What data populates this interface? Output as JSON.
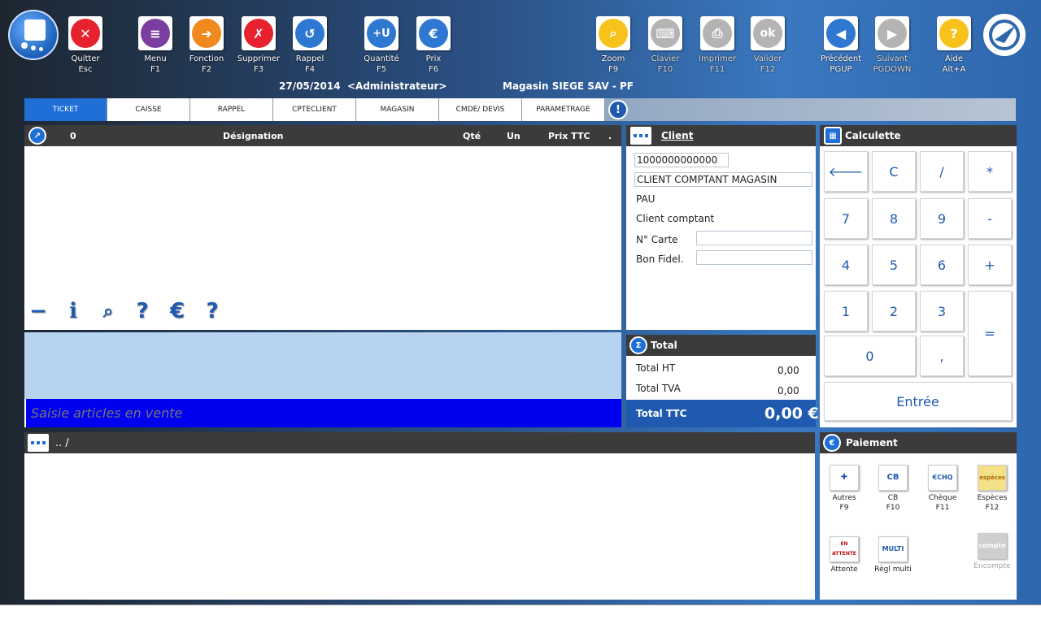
{
  "toolbar": [
    {
      "id": "quit",
      "label": "Quitter",
      "key": "Esc",
      "color": "#e8212e",
      "glyph": "✕",
      "disabled": false
    },
    {
      "id": "menu",
      "label": "Menu",
      "key": "F1",
      "color": "#7a3ea0",
      "glyph": "≡",
      "disabled": false
    },
    {
      "id": "function",
      "label": "Fonction",
      "key": "F2",
      "color": "#f08a1e",
      "glyph": "➜",
      "disabled": false
    },
    {
      "id": "delete",
      "label": "Supprimer",
      "key": "F3",
      "color": "#e8212e",
      "glyph": "✗",
      "disabled": false
    },
    {
      "id": "recall",
      "label": "Rappel",
      "key": "F4",
      "color": "#2f78d2",
      "glyph": "↺",
      "disabled": false
    },
    {
      "id": "quantity",
      "label": "Quantité",
      "key": "F5",
      "color": "#2f78d2",
      "glyph": "+U",
      "disabled": false
    },
    {
      "id": "price",
      "label": "Prix",
      "key": "F6",
      "color": "#2f78d2",
      "glyph": "€",
      "disabled": false
    },
    {
      "id": "zoom",
      "label": "Zoom",
      "key": "F9",
      "color": "#f7c31b",
      "glyph": "⌕",
      "disabled": false
    },
    {
      "id": "keyboard",
      "label": "Clavier",
      "key": "F10",
      "color": "#b4b4b4",
      "glyph": "⌨",
      "disabled": true
    },
    {
      "id": "print",
      "label": "Imprimer",
      "key": "F11",
      "color": "#b4b4b4",
      "glyph": "⎙",
      "disabled": true
    },
    {
      "id": "validate",
      "label": "Valider",
      "key": "F12",
      "color": "#b4b4b4",
      "glyph": "ok",
      "disabled": true
    },
    {
      "id": "previous",
      "label": "Précédent",
      "key": "PGUP",
      "color": "#2f78d2",
      "glyph": "◀",
      "disabled": false
    },
    {
      "id": "next",
      "label": "Suivant",
      "key": "PGDOWN",
      "color": "#b4b4b4",
      "glyph": "▶",
      "disabled": true
    },
    {
      "id": "help",
      "label": "Aide",
      "key": "Alt+A",
      "color": "#f7c31b",
      "glyph": "?",
      "disabled": false
    }
  ],
  "infobar": {
    "date": "27/05/2014",
    "user": "<Administrateur>",
    "store": "Magasin SIEGE SAV - PF"
  },
  "tabs": [
    "TICKET",
    "CAISSE",
    "RAPPEL",
    "CPTECLIENT",
    "MAGASIN",
    "CMDE/ DEVIS",
    "PARAMETRAGE"
  ],
  "ticket": {
    "count": "0",
    "columns": {
      "designation": "Désignation",
      "qty": "Qté",
      "unit": "Un",
      "price": "Prix TTC",
      "dot": "."
    },
    "icons": [
      "minus-icon",
      "info-icon",
      "search-icon",
      "help-icon",
      "euro-net-icon",
      "help2-icon"
    ]
  },
  "entry": {
    "placeholder": "Saisie articles en vente"
  },
  "client": {
    "title": "Client",
    "code": "1000000000000",
    "name": "CLIENT COMPTANT MAGASIN",
    "city": "PAU",
    "type": "Client comptant",
    "card_label": "N° Carte",
    "card_value": "",
    "fidel_label": "Bon Fidel.",
    "fidel_value": ""
  },
  "total": {
    "title": "Total",
    "ht_label": "Total HT",
    "ht_value": "0,00",
    "tva_label": "Total TVA",
    "tva_value": "0,00",
    "ttc_label": "Total TTC",
    "ttc_value": "0,00 €"
  },
  "calc": {
    "title": "Calculette",
    "keys": {
      "back": "🡐",
      "c": "C",
      "div": "/",
      "mul": "*",
      "k7": "7",
      "k8": "8",
      "k9": "9",
      "minus": "-",
      "k4": "4",
      "k5": "5",
      "k6": "6",
      "plus": "+",
      "k1": "1",
      "k2": "2",
      "k3": "3",
      "eq": "=",
      "k0": "0",
      "comma": ",",
      "enter": "Entrée"
    }
  },
  "path": {
    "text": ".. /"
  },
  "payment": {
    "title": "Paiement",
    "items": [
      {
        "label": "Autres",
        "key": "F9",
        "pic": "✚",
        "disabled": false
      },
      {
        "label": "CB",
        "key": "F10",
        "pic": "CB",
        "disabled": false
      },
      {
        "label": "Chèque",
        "key": "F11",
        "pic": "€CHQ",
        "disabled": false
      },
      {
        "label": "Espèces",
        "key": "F12",
        "pic": "espèces",
        "disabled": false
      },
      {
        "label": "Attente",
        "key": "",
        "pic": "EN ATTENTE",
        "disabled": false
      },
      {
        "label": "Règl multi",
        "key": "",
        "pic": "MULTI",
        "disabled": false
      },
      {
        "label": "Encompte",
        "key": "",
        "pic": "compte",
        "disabled": true
      }
    ]
  },
  "colors": {
    "accent": "#1f6fd6",
    "entry_bg": "#0000f0",
    "ticket_preview": "#b8d3f0",
    "total_ttc_bg": "#1f5ab0"
  }
}
